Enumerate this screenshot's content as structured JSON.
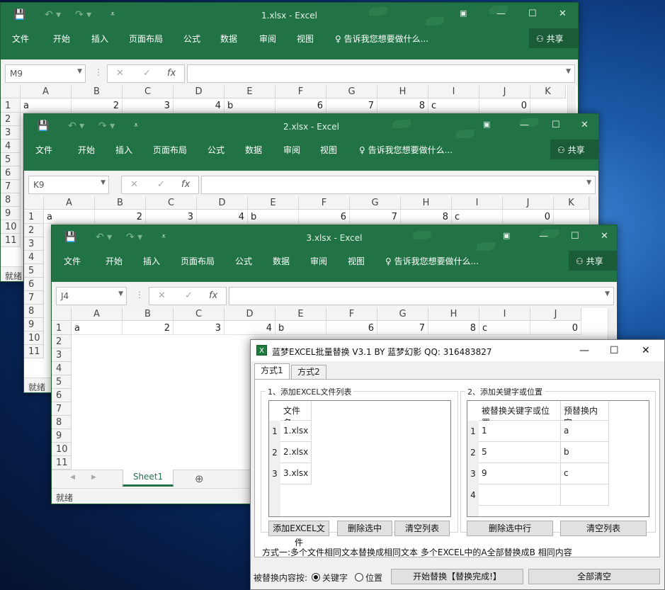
{
  "excel": {
    "menu": [
      "文件",
      "开始",
      "插入",
      "页面布局",
      "公式",
      "数据",
      "审阅",
      "视图"
    ],
    "tell_me": "告诉我您想要做什么...",
    "share": "共享",
    "fx": "fx",
    "status": "就绪",
    "sheet_tab": "Sheet1",
    "columns": [
      "A",
      "B",
      "C",
      "D",
      "E",
      "F",
      "G",
      "H",
      "I",
      "J",
      "K"
    ],
    "row1": [
      "a",
      "2",
      "3",
      "4",
      "b",
      "6",
      "7",
      "8",
      "c",
      "",
      "0"
    ],
    "windows": [
      {
        "title": "1.xlsx  -  Excel",
        "namebox": "M9",
        "rows": [
          "1",
          "2",
          "3",
          "4",
          "5",
          "6",
          "7",
          "8",
          "9",
          "10",
          "11"
        ]
      },
      {
        "title": "2.xlsx  -  Excel",
        "namebox": "K9",
        "rows": [
          "1",
          "2",
          "3",
          "4",
          "5",
          "6",
          "7",
          "8",
          "9",
          "10",
          "11"
        ]
      },
      {
        "title": "3.xlsx  -  Excel",
        "namebox": "J4",
        "rows": [
          "1",
          "2",
          "3",
          "4",
          "5",
          "6",
          "7",
          "8",
          "9",
          "10",
          "11"
        ]
      }
    ]
  },
  "dialog": {
    "title": "蓝梦EXCEL批量替换 V3.1 BY 蓝梦幻影 QQ:  316483827",
    "tabs": [
      "方式1",
      "方式2"
    ],
    "group1_label": "1、添加EXCEL文件列表",
    "group2_label": "2、添加关键字或位置",
    "files_header": "文件名",
    "files": [
      "1.xlsx",
      "2.xlsx",
      "3.xlsx"
    ],
    "file_row_nums": [
      "1",
      "2",
      "3"
    ],
    "kw_headers": [
      "被替换关键字或位置",
      "预替换内容"
    ],
    "kw_row_nums": [
      "1",
      "2",
      "3",
      "4"
    ],
    "keywords": [
      [
        "1",
        "a"
      ],
      [
        "5",
        "b"
      ],
      [
        "9",
        "c"
      ],
      [
        "",
        ""
      ]
    ],
    "btn_add": "添加EXCEL文件",
    "btn_del": "删除选中",
    "btn_clear": "清空列表",
    "btn_del_row": "删除选中行",
    "btn_clear2": "清空列表",
    "note": "方式一:多个文件相同文本替换成相同文本  多个EXCEL中的A全部替换成B 相同内容",
    "replace_label": "被替换内容按:",
    "radio_keyword": "关键字",
    "radio_position": "位置",
    "btn_start": "开始替换【替换完成!】",
    "btn_clear_all": "全部清空"
  }
}
